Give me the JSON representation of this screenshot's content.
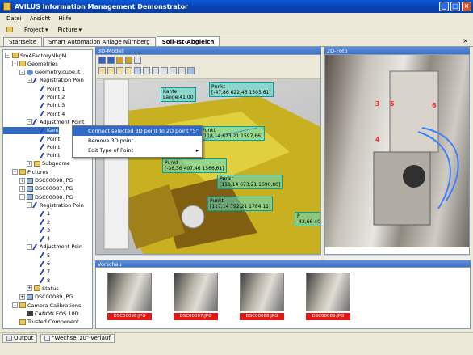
{
  "window": {
    "title": "AVILUS Information Management Demonstrator"
  },
  "menu": [
    "Datei",
    "Ansicht",
    "Hilfe"
  ],
  "toolbar": {
    "project": "Project",
    "picture": "Picture"
  },
  "tabs": [
    "Startseite",
    "Smart Automation Anlage Nürnberg",
    "Soll-Ist-Abgleich"
  ],
  "tree": [
    {
      "label": "SmAFactoryNbgM",
      "level": 0,
      "icon": "folder",
      "exp": "-"
    },
    {
      "label": "Geometries",
      "level": 1,
      "icon": "folder",
      "exp": "-"
    },
    {
      "label": "Geometry:cube.jt",
      "level": 2,
      "icon": "geo",
      "exp": "-"
    },
    {
      "label": "Registration Poin",
      "level": 3,
      "icon": "pt",
      "exp": "-"
    },
    {
      "label": "Point 1",
      "level": 4,
      "icon": "pt",
      "exp": ""
    },
    {
      "label": "Point 2",
      "level": 4,
      "icon": "pt",
      "exp": ""
    },
    {
      "label": "Point 3",
      "level": 4,
      "icon": "pt",
      "exp": ""
    },
    {
      "label": "Point 4",
      "level": 4,
      "icon": "pt",
      "exp": ""
    },
    {
      "label": "Adjustment Point",
      "level": 3,
      "icon": "pt",
      "exp": "-"
    },
    {
      "label": "Kant",
      "level": 4,
      "icon": "pt",
      "exp": ""
    },
    {
      "label": "Point",
      "level": 4,
      "icon": "pt",
      "exp": ""
    },
    {
      "label": "Point",
      "level": 4,
      "icon": "pt",
      "exp": ""
    },
    {
      "label": "Point",
      "level": 4,
      "icon": "pt",
      "exp": ""
    },
    {
      "label": "Subgeome",
      "level": 3,
      "icon": "folder",
      "exp": "+"
    },
    {
      "label": "Pictures",
      "level": 1,
      "icon": "folder",
      "exp": "-"
    },
    {
      "label": "DSC00098.JPG",
      "level": 2,
      "icon": "pic",
      "exp": "+"
    },
    {
      "label": "DSC00087.JPG",
      "level": 2,
      "icon": "pic",
      "exp": "+"
    },
    {
      "label": "DSC00088.JPG",
      "level": 2,
      "icon": "pic",
      "exp": "-"
    },
    {
      "label": "Registration Poin",
      "level": 3,
      "icon": "pt",
      "exp": "-"
    },
    {
      "label": "1",
      "level": 4,
      "icon": "pt",
      "exp": ""
    },
    {
      "label": "2",
      "level": 4,
      "icon": "pt",
      "exp": ""
    },
    {
      "label": "3",
      "level": 4,
      "icon": "pt",
      "exp": ""
    },
    {
      "label": "4",
      "level": 4,
      "icon": "pt",
      "exp": ""
    },
    {
      "label": "Adjustment Poin",
      "level": 3,
      "icon": "pt",
      "exp": "-"
    },
    {
      "label": "5",
      "level": 4,
      "icon": "pt",
      "exp": ""
    },
    {
      "label": "6",
      "level": 4,
      "icon": "pt",
      "exp": ""
    },
    {
      "label": "7",
      "level": 4,
      "icon": "pt",
      "exp": ""
    },
    {
      "label": "8",
      "level": 4,
      "icon": "pt",
      "exp": ""
    },
    {
      "label": "Status",
      "level": 3,
      "icon": "folder",
      "exp": "+"
    },
    {
      "label": "DSC00089.JPG",
      "level": 2,
      "icon": "pic",
      "exp": "+"
    },
    {
      "label": "Camera Calibrations",
      "level": 1,
      "icon": "folder",
      "exp": "-"
    },
    {
      "label": "CANON EOS 10D",
      "level": 2,
      "icon": "cam",
      "exp": ""
    },
    {
      "label": "Trusted Component",
      "level": 1,
      "icon": "folder",
      "exp": ""
    }
  ],
  "panels": {
    "model3d": "3D-Modell",
    "photo2d": "2D-Foto",
    "preview": "Vorschau"
  },
  "view3d_labels": [
    {
      "text": "Kante\nLänge:41,00"
    },
    {
      "text": "Punkt\n[-47,86 622,46 1503,61]"
    },
    {
      "text": "Punkt\n[118,14 673,21 1597,66]"
    },
    {
      "text": "Punkt\n[-36,36 407,46 1566,61]"
    },
    {
      "text": "Punkt\n[118,14 673,21 1696,80]"
    },
    {
      "text": "Punkt\n[117,14 792,21 1784,11]"
    },
    {
      "text": "P\n-42,66 404,"
    }
  ],
  "context_menu": [
    {
      "label": "Connect selected 3D point to 2D point \"5\"",
      "highlight": true
    },
    {
      "label": "Remove 3D point",
      "highlight": false
    },
    {
      "label": "Edit Type of Point",
      "highlight": false,
      "submenu": true
    }
  ],
  "photo_points": [
    "3",
    "5",
    "6",
    "4"
  ],
  "thumbnails": [
    "DSC00098.JPG",
    "DSC00087.JPG",
    "DSC00088.JPG",
    "DSC00089.JPG"
  ],
  "statusbar": {
    "output": "Output",
    "history": "\"Wechsel zu\"-Verlauf"
  }
}
